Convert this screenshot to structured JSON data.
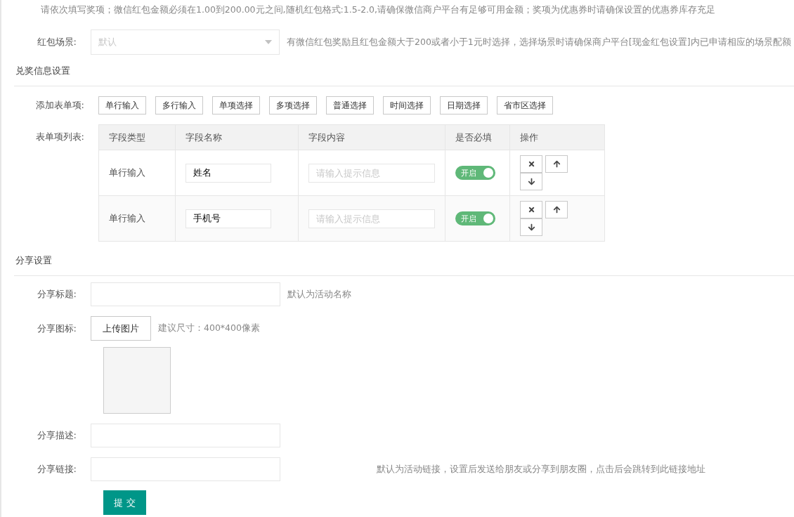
{
  "notice": "请依次填写奖项；微信红包金额必须在1.00到200.00元之间,随机红包格式:1.5-2.0,请确保微信商户平台有足够可用金额；奖项为优惠券时请确保设置的优惠券库存充足",
  "red_packet_scene": {
    "label": "红包场景:",
    "value": "默认",
    "disabled": true,
    "hint": "有微信红包奖励且红包金额大于200或者小于1元时选择，选择场景时请确保商户平台[现金红包设置]内已申请相应的场景配额"
  },
  "redeem_settings": {
    "title": "兑奖信息设置",
    "add_label": "添加表单项:",
    "add_buttons": [
      "单行输入",
      "多行输入",
      "单项选择",
      "多项选择",
      "普通选择",
      "时间选择",
      "日期选择",
      "省市区选择"
    ],
    "list_label": "表单项列表:",
    "columns": [
      "字段类型",
      "字段名称",
      "字段内容",
      "是否必填",
      "操作"
    ],
    "rows": [
      {
        "type": "单行输入",
        "name": "姓名",
        "content_placeholder": "请输入提示信息",
        "required": {
          "label": "开启",
          "on": true
        }
      },
      {
        "type": "单行输入",
        "name": "手机号",
        "content_placeholder": "请输入提示信息",
        "required": {
          "label": "开启",
          "on": true
        }
      }
    ]
  },
  "share_settings": {
    "title": "分享设置",
    "fields": [
      {
        "kind": "text",
        "label": "分享标题:",
        "hint": "默认为活动名称"
      },
      {
        "kind": "image",
        "label": "分享图标:",
        "button": "上传图片",
        "hint": "建议尺寸：400*400像素"
      },
      {
        "kind": "text",
        "label": "分享描述:"
      },
      {
        "kind": "link",
        "label": "分享链接:",
        "hint": "默认为活动链接，设置后发送给朋友或分享到朋友圈，点击后会跳转到此链接地址"
      }
    ]
  },
  "submit": "提 交"
}
